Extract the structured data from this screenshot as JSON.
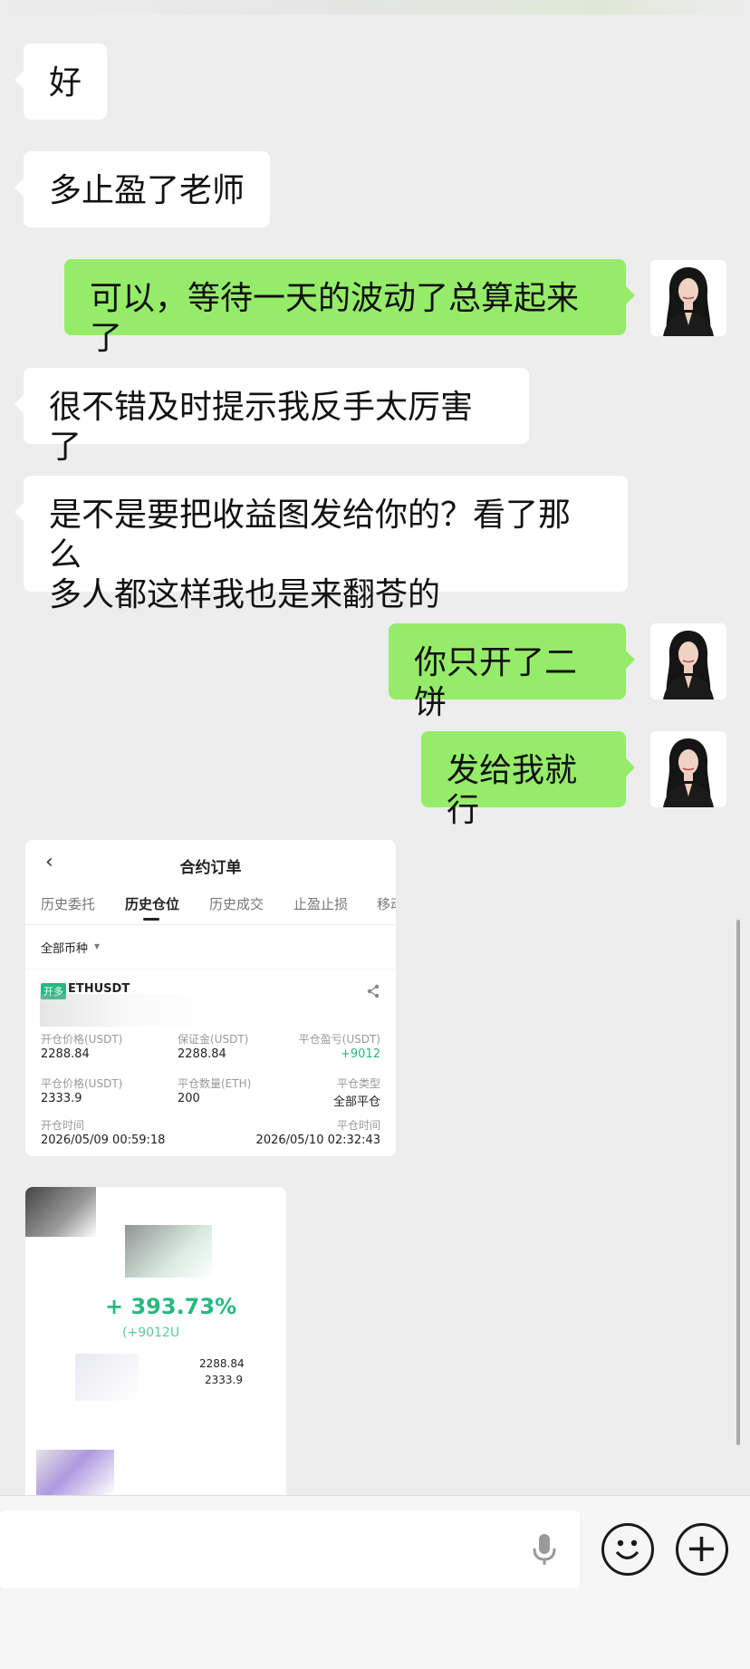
{
  "messages": [
    {
      "side": "in",
      "text": "好"
    },
    {
      "side": "in",
      "text": "多止盈了老师"
    },
    {
      "side": "out",
      "text": "可以，等待一天的波动了总算起来了"
    },
    {
      "side": "in",
      "text": "很不错及时提示我反手太厉害了"
    },
    {
      "side": "in",
      "text_lines": [
        "是不是要把收益图发给你的？看了那么",
        "多人都这样我也是来翻苍的"
      ]
    },
    {
      "side": "out",
      "text": "你只开了二饼"
    },
    {
      "side": "out",
      "text": "发给我就行"
    }
  ],
  "order_card": {
    "title": "合约订单",
    "tabs": [
      "历史委托",
      "历史仓位",
      "历史成交",
      "止盈止损",
      "移动"
    ],
    "active_tab": "历史仓位",
    "filter": "全部币种",
    "tag": "开多",
    "symbol": "ETHUSDT",
    "fields": {
      "open_price_label": "开仓价格(USDT)",
      "open_price": "2288.84",
      "margin_label": "保证金(USDT)",
      "margin": "2288.84",
      "pnl_label": "平仓盈亏(USDT)",
      "pnl": "+9012",
      "close_price_label": "平仓价格(USDT)",
      "close_price": "2333.9",
      "close_qty_label": "平仓数量(ETH)",
      "close_qty": "200",
      "close_type_label": "平仓类型",
      "close_type": "全部平仓",
      "open_time_label": "开仓时间",
      "open_time": "2026/05/09 00:59:18",
      "close_time_label": "平仓时间",
      "close_time": "2026/05/10 02:32:43"
    }
  },
  "profit_card": {
    "percent": "+ 393.73%",
    "amount": "(+9012U",
    "price1": "2288.84",
    "price2": "2333.9"
  },
  "colors": {
    "incoming": "#ffffff",
    "outgoing": "#95ec69",
    "profit_green": "#26b980"
  }
}
